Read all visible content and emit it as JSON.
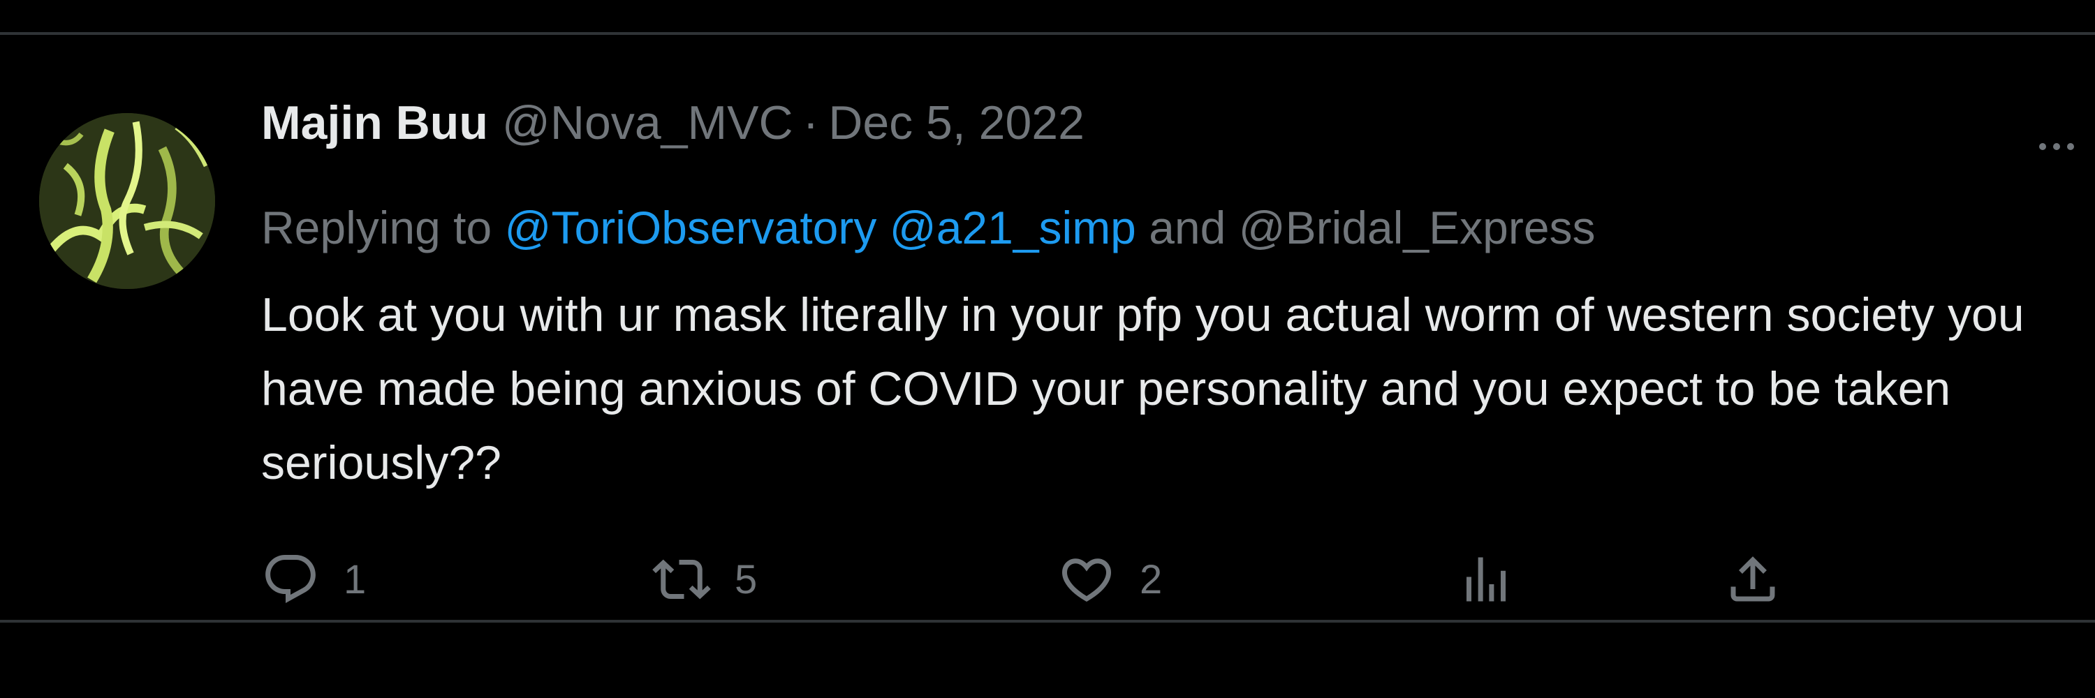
{
  "tweet": {
    "author": {
      "display_name": "Majin Buu",
      "handle": "@Nova_MVC",
      "separator": "·",
      "date": "Dec 5, 2022"
    },
    "reply_context": {
      "prefix": "Replying to",
      "mentions": [
        "@ToriObservatory",
        "@a21_simp"
      ],
      "conjunction": "and",
      "last_mention": "@Bridal_Express"
    },
    "text": "Look at you with ur mask literally in your pfp you actual worm of western society you have made being anxious of COVID your personality and you expect to be taken seriously??",
    "actions": {
      "reply": {
        "icon": "reply-icon",
        "count": "1"
      },
      "retweet": {
        "icon": "retweet-icon",
        "count": "5"
      },
      "like": {
        "icon": "heart-icon",
        "count": "2"
      },
      "views": {
        "icon": "analytics-icon"
      },
      "share": {
        "icon": "share-icon"
      }
    }
  },
  "colors": {
    "background": "#000000",
    "text_primary": "#e7e9ea",
    "text_secondary": "#71767b",
    "link": "#1d9bf0",
    "divider": "#2f3336"
  }
}
